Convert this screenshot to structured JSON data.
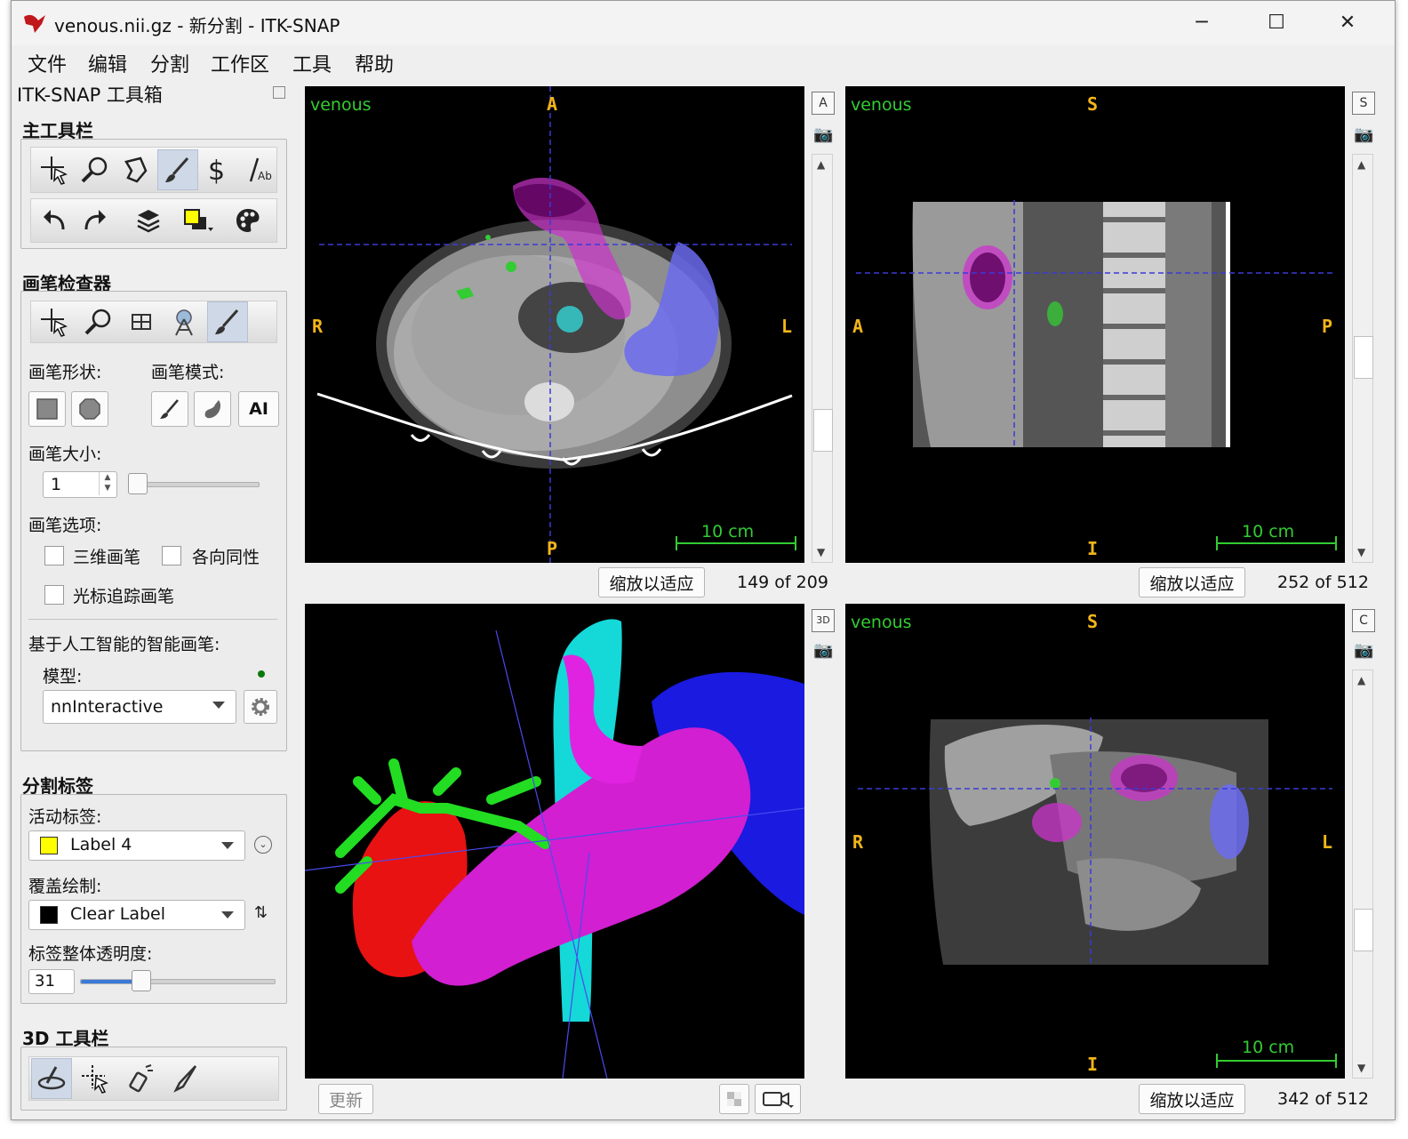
{
  "window": {
    "title": "venous.nii.gz - 新分割 - ITK-SNAP",
    "minimize": "─",
    "maximize": "☐",
    "close": "✕"
  },
  "menu": [
    "文件",
    "编辑",
    "分割",
    "工作区",
    "工具",
    "帮助"
  ],
  "toolbox": {
    "title": "ITK-SNAP 工具箱",
    "main_toolbar_title": "主工具栏",
    "paint_inspector_title": "画笔检查器",
    "brush_shape_label": "画笔形状:",
    "brush_mode_label": "画笔模式:",
    "ai_button": "AI",
    "brush_size_label": "画笔大小:",
    "brush_size_value": "1",
    "brush_options_label": "画笔选项:",
    "opt_3d": "三维画笔",
    "opt_isotropic": "各向同性",
    "opt_cursor_chase": "光标追踪画笔",
    "ai_section_label": "基于人工智能的智能画笔:",
    "model_label": "模型:",
    "model_value": "nnInteractive",
    "seg_labels_title": "分割标签",
    "active_label_label": "活动标签:",
    "active_label_value": "Label 4",
    "active_label_color": "#ffff00",
    "draw_over_label": "覆盖绘制:",
    "draw_over_value": "Clear Label",
    "draw_over_color": "#000000",
    "opacity_label": "标签整体透明度:",
    "opacity_value": "31",
    "opacity_fraction": 0.31,
    "toolbar3d_title": "3D 工具栏"
  },
  "views": {
    "axial": {
      "layer": "venous",
      "top": "A",
      "bottom": "P",
      "left": "R",
      "right": "L",
      "scale": "10 cm",
      "fit_button": "缩放以适应",
      "slice": "149 of 209",
      "side_tag": "A"
    },
    "sagittal": {
      "layer": "venous",
      "top": "S",
      "bottom": "I",
      "left": "A",
      "right": "P",
      "scale": "10 cm",
      "fit_button": "缩放以适应",
      "slice": "252 of 512",
      "side_tag": "S"
    },
    "render3d": {
      "update_button": "更新",
      "side_tag": "3D"
    },
    "coronal": {
      "layer": "venous",
      "top": "S",
      "bottom": "I",
      "left": "R",
      "right": "L",
      "scale": "10 cm",
      "fit_button": "缩放以适应",
      "slice": "342 of 512",
      "side_tag": "C"
    }
  },
  "colors": {
    "overlay_green": "#33cc33",
    "crosshair": "#3a3ad8",
    "orientation": "#f2b51a",
    "stomach": "#cc33cc",
    "spleen": "#3333ee",
    "aorta": "#00e5e5",
    "liver_red": "#ee1111",
    "vessel_green": "#22dd22"
  }
}
